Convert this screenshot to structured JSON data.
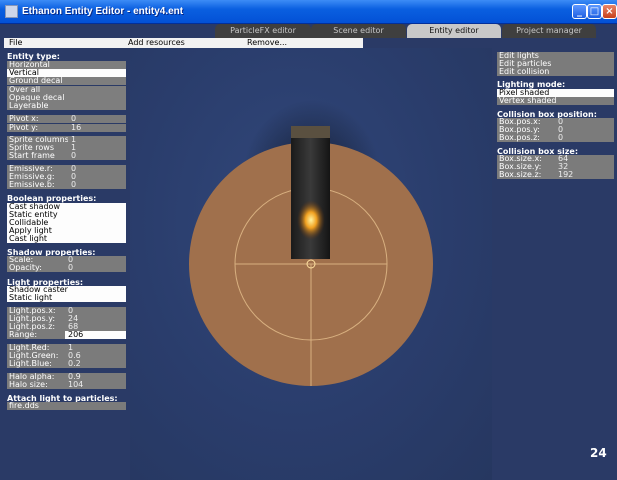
{
  "window": {
    "title": "Ethanon Entity Editor - entity4.ent"
  },
  "tabs": [
    "ParticleFX editor",
    "Scene editor",
    "Entity editor",
    "Project manager"
  ],
  "menu": {
    "file": "File",
    "add_resources": "Add resources",
    "remove": "Remove..."
  },
  "left": {
    "entity_type_header": "Entity type:",
    "entity_types": [
      "Horizontal",
      "Vertical",
      "Ground decal",
      "Over all",
      "Opaque decal",
      "Layerable"
    ],
    "selected_entity_type": "Vertical",
    "pivot_x": {
      "label": "Pivot x:",
      "value": "0"
    },
    "pivot_y": {
      "label": "Pivot y:",
      "value": "16"
    },
    "sprite_columns": {
      "label": "Sprite columns",
      "value": "1"
    },
    "sprite_rows": {
      "label": "Sprite rows",
      "value": "1"
    },
    "start_frame": {
      "label": "Start frame",
      "value": "0"
    },
    "emissive_r": {
      "label": "Emissive.r:",
      "value": "0"
    },
    "emissive_g": {
      "label": "Emissive.g:",
      "value": "0"
    },
    "emissive_b": {
      "label": "Emissive.b:",
      "value": "0"
    },
    "boolean_header": "Boolean properties:",
    "boolean_props": [
      "Cast shadow",
      "Static entity",
      "Collidable",
      "Apply light",
      "Cast light"
    ],
    "shadow_header": "Shadow properties:",
    "shadow_scale": {
      "label": "Scale:",
      "value": "0"
    },
    "shadow_opacity": {
      "label": "Opacity:",
      "value": "0"
    },
    "light_header": "Light properties:",
    "light_props": [
      "Shadow caster",
      "Static light"
    ],
    "light_pos_x": {
      "label": "Light.pos.x:",
      "value": "0"
    },
    "light_pos_y": {
      "label": "Light.pos.y:",
      "value": "24"
    },
    "light_pos_z": {
      "label": "Light.pos.z:",
      "value": "68"
    },
    "range": {
      "label": "Range:",
      "value": "206"
    },
    "light_red": {
      "label": "Light.Red:",
      "value": "1"
    },
    "light_green": {
      "label": "Light.Green:",
      "value": "0.6"
    },
    "light_blue": {
      "label": "Light.Blue:",
      "value": "0.2"
    },
    "halo_alpha": {
      "label": "Halo alpha:",
      "value": "0.9"
    },
    "halo_size": {
      "label": "Halo size:",
      "value": "104"
    },
    "attach_header": "Attach light to particles:",
    "attach_value": "fire.dds"
  },
  "right": {
    "buttons": [
      "Edit lights",
      "Edit particles",
      "Edit collision"
    ],
    "lighting_mode_header": "Lighting mode:",
    "lighting_modes": [
      "Pixel shaded",
      "Vertex shaded"
    ],
    "selected_lighting_mode": "Pixel shaded",
    "collision_pos_header": "Collision box position:",
    "box_pos_x": {
      "label": "Box.pos.x:",
      "value": "0"
    },
    "box_pos_y": {
      "label": "Box.pos.y:",
      "value": "0"
    },
    "box_pos_z": {
      "label": "Box.pos.z:",
      "value": "0"
    },
    "collision_size_header": "Collision box size:",
    "box_size_x": {
      "label": "Box.size.x:",
      "value": "64"
    },
    "box_size_y": {
      "label": "Box.size.y:",
      "value": "32"
    },
    "box_size_z": {
      "label": "Box.size.z:",
      "value": "192"
    }
  },
  "fps": "24",
  "colors": {
    "light_halo": "#a0704c",
    "background": "#2a3a66",
    "titlebar": "#0a5fe0"
  }
}
